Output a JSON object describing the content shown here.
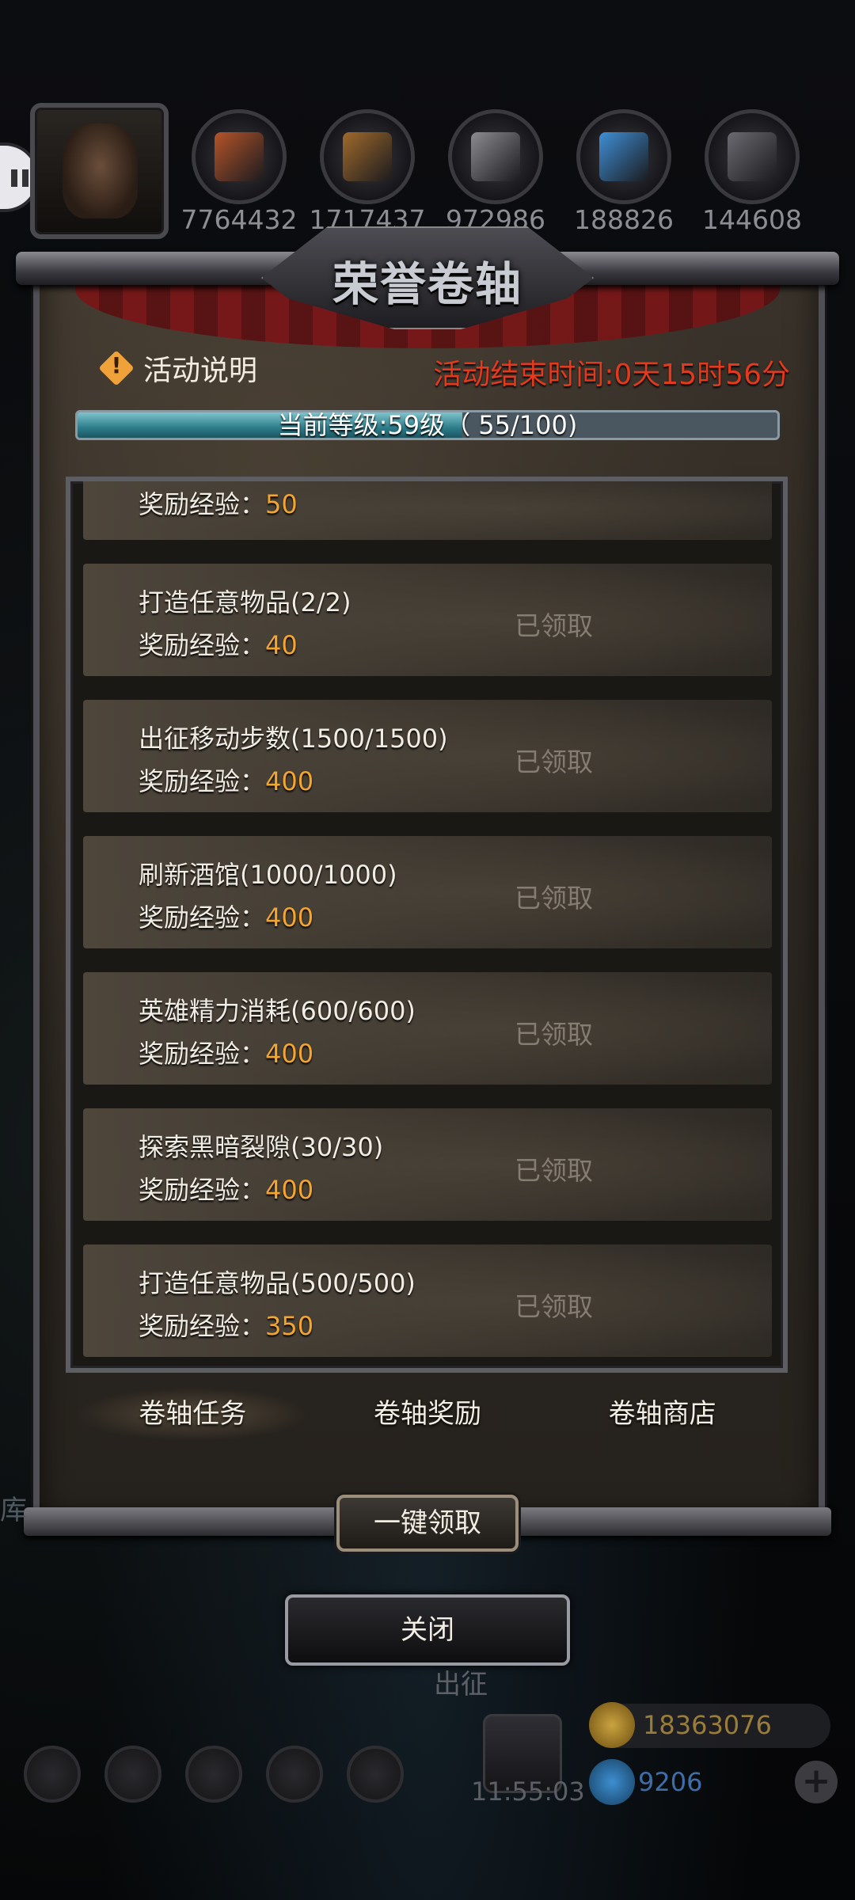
{
  "resources": [
    {
      "icon": "copper-ore-icon",
      "color": "#b5542a",
      "value": "7764432"
    },
    {
      "icon": "wood-planks-icon",
      "color": "#a06a2b",
      "value": "1717437"
    },
    {
      "icon": "iron-ingot-icon",
      "color": "#8b8b90",
      "value": "972986"
    },
    {
      "icon": "blue-crystal-icon",
      "color": "#3f8fd6",
      "value": "188826"
    },
    {
      "icon": "steel-ingot-icon",
      "color": "#6a6a70",
      "value": "144608"
    }
  ],
  "panel": {
    "title": "荣誉卷轴",
    "info_label": "活动说明",
    "end_time": "活动结束时间:0天15时56分",
    "level_text": "当前等级:59级（ 55/100)",
    "level_progress": 0.55
  },
  "tasks": [
    {
      "name": "",
      "reward_label": "奖励经验：",
      "reward": "50",
      "status": ""
    },
    {
      "name": "打造任意物品(2/2)",
      "reward_label": "奖励经验：",
      "reward": "40",
      "status": "已领取"
    },
    {
      "name": "出征移动步数(1500/1500)",
      "reward_label": "奖励经验：",
      "reward": "400",
      "status": "已领取"
    },
    {
      "name": "刷新酒馆(1000/1000)",
      "reward_label": "奖励经验：",
      "reward": "400",
      "status": "已领取"
    },
    {
      "name": "英雄精力消耗(600/600)",
      "reward_label": "奖励经验：",
      "reward": "400",
      "status": "已领取"
    },
    {
      "name": "探索黑暗裂隙(30/30)",
      "reward_label": "奖励经验：",
      "reward": "400",
      "status": "已领取"
    },
    {
      "name": "打造任意物品(500/500)",
      "reward_label": "奖励经验：",
      "reward": "350",
      "status": "已领取"
    }
  ],
  "tabs": [
    "卷轴任务",
    "卷轴奖励",
    "卷轴商店"
  ],
  "buttons": {
    "claim_all": "一键领取",
    "close": "关闭"
  },
  "background": {
    "march_label": "出征",
    "ku_label": "库",
    "clock": "11:55:03",
    "gold": "18363076",
    "gems": "9206"
  }
}
